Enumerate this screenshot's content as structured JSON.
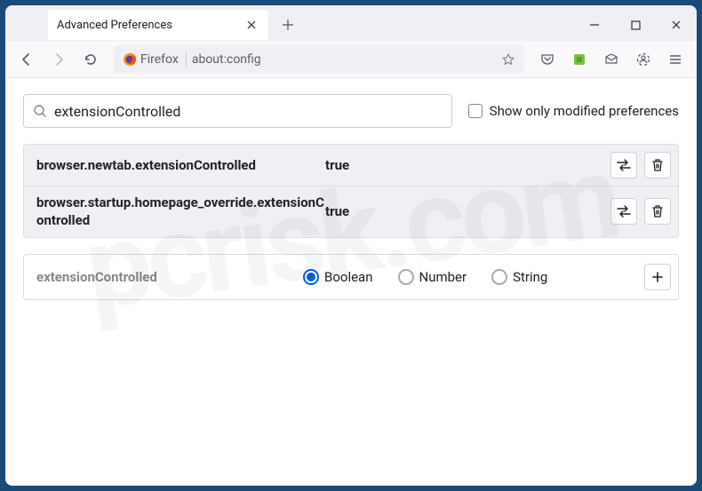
{
  "tab": {
    "title": "Advanced Preferences"
  },
  "addressbar": {
    "identity": "Firefox",
    "url": "about:config"
  },
  "search": {
    "value": "extensionControlled",
    "checkbox_label": "Show only modified preferences"
  },
  "prefs": [
    {
      "name": "browser.newtab.extensionControlled",
      "value": "true"
    },
    {
      "name": "browser.startup.homepage_override.extensionControlled",
      "value": "true"
    }
  ],
  "new_pref": {
    "name": "extensionControlled",
    "types": {
      "boolean": "Boolean",
      "number": "Number",
      "string": "String"
    },
    "selected": "boolean"
  }
}
